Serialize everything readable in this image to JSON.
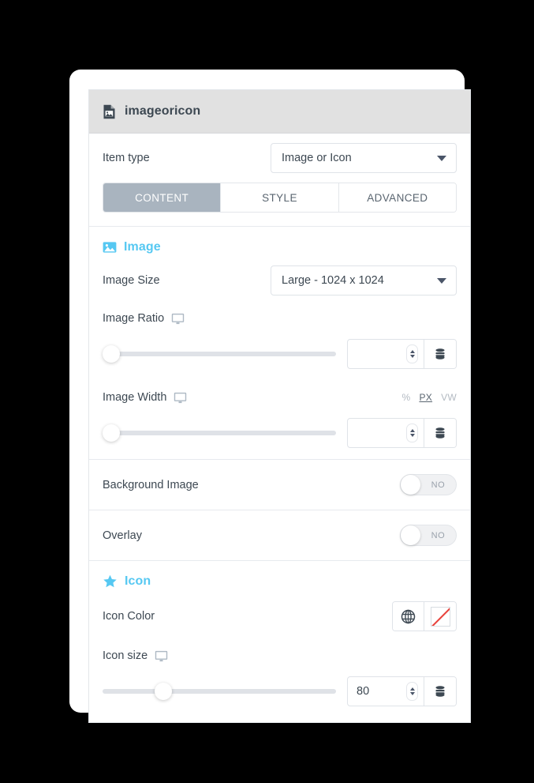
{
  "panel": {
    "header": {
      "icon": "file-image-icon",
      "title": "imageoricon"
    },
    "item_type": {
      "label": "Item type",
      "value": "Image or Icon",
      "caret_icon": "chevron-down-icon"
    },
    "tabs": [
      {
        "label": "CONTENT",
        "active": true
      },
      {
        "label": "STYLE",
        "active": false
      },
      {
        "label": "ADVANCED",
        "active": false
      }
    ],
    "sections": [
      {
        "key": "image",
        "icon": "image-icon",
        "title": "Image",
        "image_size": {
          "label": "Image Size",
          "value": "Large - 1024 x 1024",
          "caret_icon": "chevron-down-icon"
        },
        "image_ratio": {
          "label": "Image Ratio",
          "device_icon": "desktop-monitor-icon",
          "slider_percent": 0,
          "value": "",
          "spinner_icon": "spinner-updown-icon",
          "dynamic_icon": "database-icon"
        },
        "image_width": {
          "label": "Image Width",
          "device_icon": "desktop-monitor-icon",
          "units": [
            {
              "label": "%",
              "active": false
            },
            {
              "label": "PX",
              "active": true
            },
            {
              "label": "VW",
              "active": false
            }
          ],
          "slider_percent": 0,
          "value": "",
          "spinner_icon": "spinner-updown-icon",
          "dynamic_icon": "database-icon"
        }
      }
    ],
    "toggles": [
      {
        "key": "background_image",
        "label": "Background Image",
        "state": "NO",
        "on": false
      },
      {
        "key": "overlay",
        "label": "Overlay",
        "state": "NO",
        "on": false
      }
    ],
    "icon_section": {
      "icon": "star-icon",
      "title": "Icon",
      "icon_color": {
        "label": "Icon Color",
        "globe_icon": "globe-icon",
        "swatch_icon": "no-color-swatch-icon"
      },
      "icon_size": {
        "label": "Icon size",
        "device_icon": "desktop-monitor-icon",
        "slider_percent": 24,
        "value": "80",
        "spinner_icon": "spinner-updown-icon",
        "dynamic_icon": "database-icon"
      }
    }
  },
  "colors": {
    "background": "#000000",
    "card": "#ffffff",
    "header_bg": "#e1e1e1",
    "accent_cyan": "#56c8f2",
    "active_tab_bg": "#a9b4bf",
    "text_primary": "#3d4852",
    "text_muted": "#9aa2ac",
    "border": "#dfe3e8",
    "slider_track": "#dfe2e7",
    "no_color_slash": "#e8413a"
  }
}
